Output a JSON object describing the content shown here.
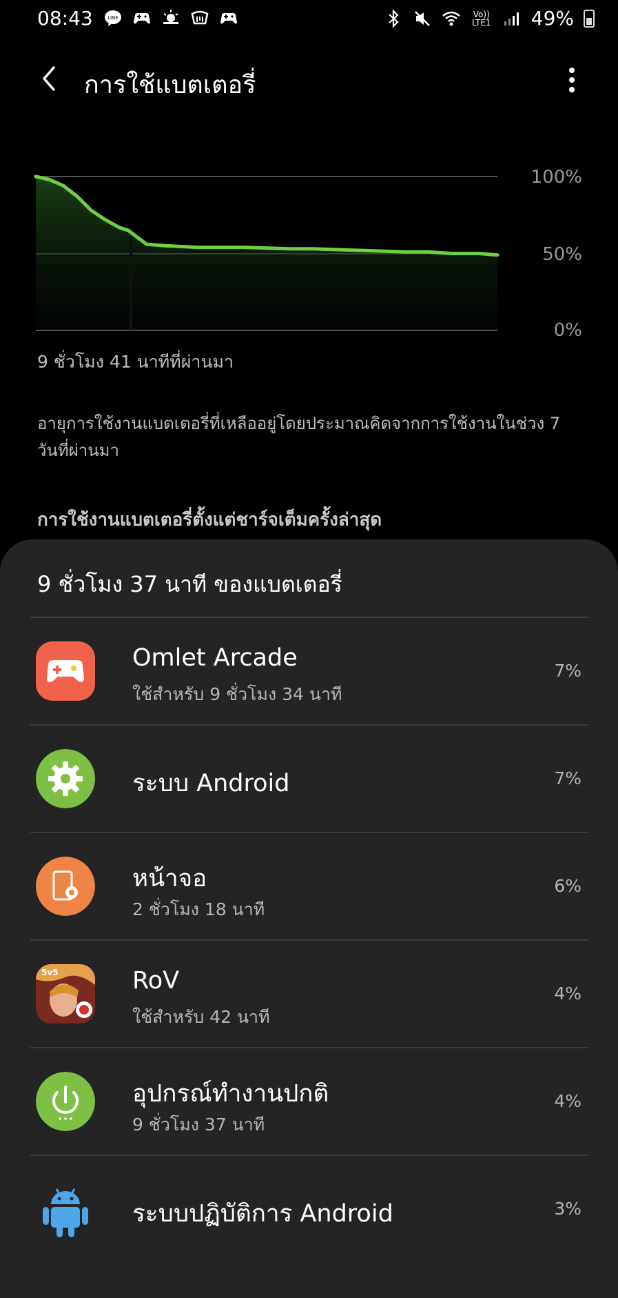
{
  "status_bar": {
    "time": "08:43",
    "battery": "49%",
    "network_label_top": "Vo))",
    "network_label_bottom": "LTE1"
  },
  "header": {
    "title": "การใช้แบตเตอรี่"
  },
  "chart_data": {
    "type": "area",
    "y_ticks": [
      "100%",
      "50%",
      "0%"
    ],
    "ylim": [
      0,
      100
    ],
    "x": [
      0,
      3,
      6,
      9,
      12,
      15,
      18,
      20,
      24,
      28,
      35,
      45,
      55,
      60,
      70,
      80,
      85,
      90,
      96,
      100
    ],
    "y": [
      100,
      98,
      94,
      87,
      78,
      72,
      67,
      65,
      56,
      55,
      54,
      54,
      53,
      53,
      52,
      51,
      51,
      50,
      50,
      49
    ],
    "xlim": [
      0,
      100
    ],
    "line_color": "#6fd13f"
  },
  "elapsed_label": "9 ชั่วโมง 41 นาทีที่ผ่านมา",
  "estimate_note": "อายุการใช้งานแบตเตอรี่ที่เหลืออยู่โดยประมาณคิดจากการใช้งานในช่วง 7 วันที่ผ่านมา",
  "since_full_charge_label": "การใช้งานแบตเตอรี่ตั้งแต่ชาร์จเต็มครั้งล่าสุด",
  "sheet": {
    "title": "9 ชั่วโมง 37 นาที ของแบตเตอรี่",
    "items": [
      {
        "name": "Omlet Arcade",
        "sub": "ใช้สำหรับ 9 ชั่วโมง 34 นาที",
        "pct": "7%",
        "icon": "gamepad-icon",
        "color": "#f0624a"
      },
      {
        "name": "ระบบ Android",
        "sub": "",
        "pct": "7%",
        "icon": "gear-icon",
        "color": "#7ec043"
      },
      {
        "name": "หน้าจอ",
        "sub": "2 ชั่วโมง 18 นาที",
        "pct": "6%",
        "icon": "screen-brightness-icon",
        "color": "#ef8447"
      },
      {
        "name": "RoV",
        "sub": "ใช้สำหรับ 42 นาที",
        "pct": "4%",
        "icon": "rov-game-icon",
        "color": "#c0392b"
      },
      {
        "name": "อุปกรณ์ทำงานปกติ",
        "sub": "9 ชั่วโมง 37 นาที",
        "pct": "4%",
        "icon": "power-icon",
        "color": "#7ec043"
      },
      {
        "name": "ระบบปฏิบัติการ Android",
        "sub": "",
        "pct": "3%",
        "icon": "android-robot-icon",
        "color": "#4da6e8"
      }
    ]
  }
}
